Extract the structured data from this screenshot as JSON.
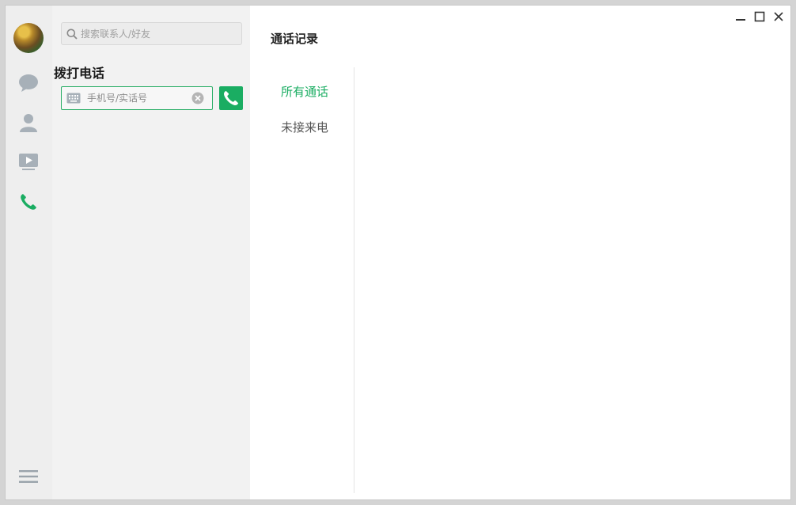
{
  "window": {
    "title": ""
  },
  "rail": {
    "items": [
      {
        "name": "chat-icon",
        "label": ""
      },
      {
        "name": "contacts-icon",
        "label": ""
      },
      {
        "name": "video-icon",
        "label": ""
      },
      {
        "name": "phone-icon",
        "label": ""
      }
    ],
    "active": "phone-icon"
  },
  "search": {
    "placeholder": "搜索联系人/好友",
    "value": ""
  },
  "dial": {
    "title": "拨打电话",
    "placeholder": "手机号/实话号",
    "value": ""
  },
  "main": {
    "title": "通话记录",
    "tabs": [
      {
        "label": "所有通话",
        "active": true
      },
      {
        "label": "未接来电",
        "active": false
      }
    ]
  },
  "colors": {
    "accent": "#1aad62",
    "rail_icon": "#a7b0b8",
    "rail_bg": "#eeeeee",
    "panel_bg": "#f2f2f2"
  }
}
